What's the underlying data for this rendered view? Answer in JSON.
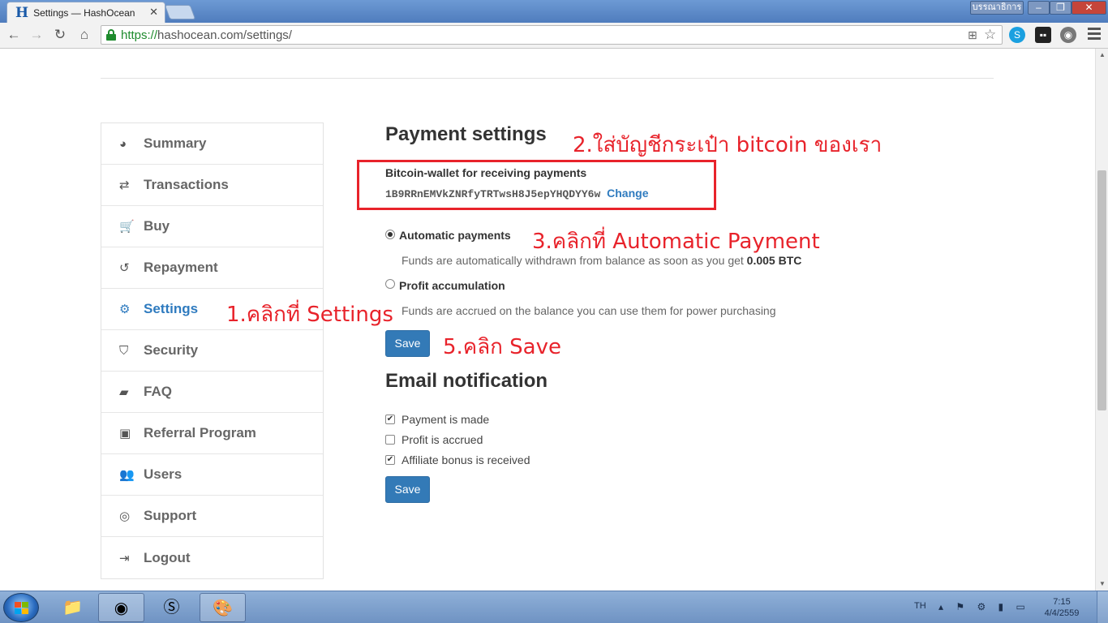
{
  "browser": {
    "tab_title": "Settings — HashOcean",
    "tab_favicon": "H",
    "profile_name": "บรรณาธิการ",
    "url_scheme": "https://",
    "url_rest": "hashocean.com/settings/"
  },
  "sidebar": {
    "items": [
      {
        "label": "Summary",
        "icon": "dashboard-icon",
        "glyph": "◕"
      },
      {
        "label": "Transactions",
        "icon": "exchange-icon",
        "glyph": "⇄"
      },
      {
        "label": "Buy",
        "icon": "cart-icon",
        "glyph": "🛒"
      },
      {
        "label": "Repayment",
        "icon": "history-icon",
        "glyph": "↺"
      },
      {
        "label": "Settings",
        "icon": "gear-icon",
        "glyph": "⚙",
        "active": true
      },
      {
        "label": "Security",
        "icon": "shield-icon",
        "glyph": "⛉"
      },
      {
        "label": "FAQ",
        "icon": "book-icon",
        "glyph": "▰"
      },
      {
        "label": "Referral Program",
        "icon": "money-icon",
        "glyph": "▣"
      },
      {
        "label": "Users",
        "icon": "users-icon",
        "glyph": "👥"
      },
      {
        "label": "Support",
        "icon": "lifebuoy-icon",
        "glyph": "◎"
      },
      {
        "label": "Logout",
        "icon": "sign-out-icon",
        "glyph": "⇥"
      }
    ]
  },
  "payment": {
    "title": "Payment settings",
    "wallet_label": "Bitcoin-wallet for receiving payments",
    "wallet_address": "1B9RRnEMVkZNRfyTRTwsH8J5epYHQDYY6w",
    "change_link": "Change",
    "options": [
      {
        "label": "Automatic payments",
        "checked": true,
        "desc_prefix": "Funds are automatically withdrawn from balance as soon as you get",
        "desc_bold": "0.005 BTC"
      },
      {
        "label": "Profit accumulation",
        "checked": false,
        "desc_prefix": "Funds are accrued on the balance you can use them for power purchasing",
        "desc_bold": ""
      }
    ],
    "save_label": "Save"
  },
  "email": {
    "title": "Email notification",
    "options": [
      {
        "label": "Payment is made",
        "checked": true
      },
      {
        "label": "Profit is accrued",
        "checked": false
      },
      {
        "label": "Affiliate bonus is received",
        "checked": true
      }
    ],
    "save_label": "Save"
  },
  "annotations": {
    "step1": "1.คลิกที่   Settings",
    "step2": "2.ใส่บัญชีกระเป๋า   bitcoin ของเรา",
    "step3": "3.คลิกที่   Automatic Payment",
    "step5": "5.คลิก   Save"
  },
  "taskbar": {
    "lang": "TH",
    "time": "7:15",
    "date": "4/4/2559"
  },
  "colors": {
    "accent": "#2f7bbf",
    "annotation": "#e8232b",
    "button": "#337ab7"
  }
}
